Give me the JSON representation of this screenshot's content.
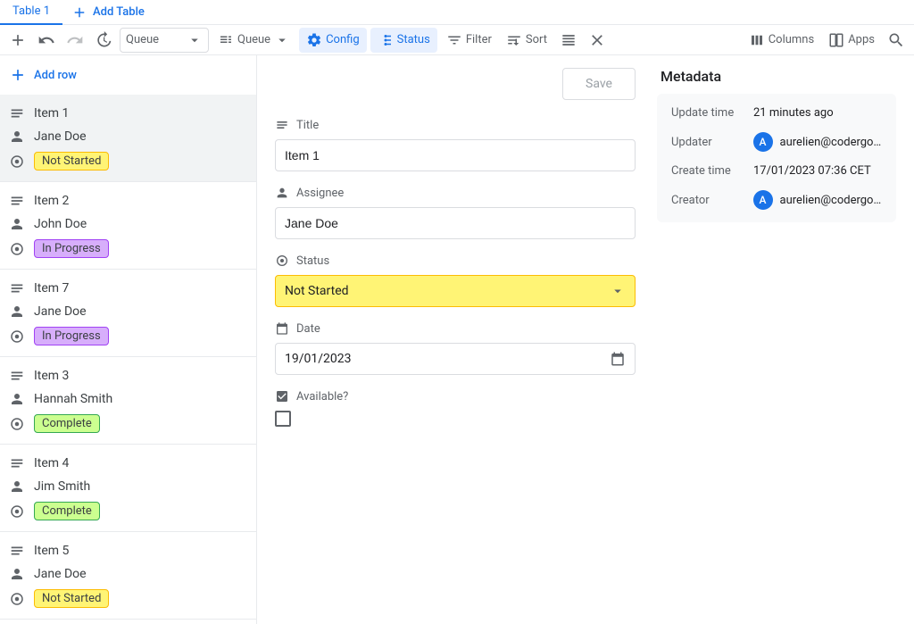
{
  "tabs": {
    "primary": "Table 1",
    "add": "Add Table"
  },
  "toolbar": {
    "view_select": "Queue",
    "layout_select": "Queue",
    "config": "Config",
    "status": "Status",
    "filter": "Filter",
    "sort": "Sort",
    "columns": "Columns",
    "apps": "Apps"
  },
  "sidebar": {
    "add_row": "Add row",
    "items": [
      {
        "title": "Item 1",
        "assignee": "Jane Doe",
        "status": "Not Started",
        "status_class": "pill-notstarted",
        "selected": true
      },
      {
        "title": "Item 2",
        "assignee": "John Doe",
        "status": "In Progress",
        "status_class": "pill-inprogress"
      },
      {
        "title": "Item 7",
        "assignee": "Jane Doe",
        "status": "In Progress",
        "status_class": "pill-inprogress"
      },
      {
        "title": "Item 3",
        "assignee": "Hannah Smith",
        "status": "Complete",
        "status_class": "pill-complete"
      },
      {
        "title": "Item 4",
        "assignee": "Jim Smith",
        "status": "Complete",
        "status_class": "pill-complete"
      },
      {
        "title": "Item 5",
        "assignee": "Jane Doe",
        "status": "Not Started",
        "status_class": "pill-notstarted"
      }
    ]
  },
  "detail": {
    "save": "Save",
    "fields": {
      "title_label": "Title",
      "title_value": "Item 1",
      "assignee_label": "Assignee",
      "assignee_value": "Jane Doe",
      "status_label": "Status",
      "status_value": "Not Started",
      "date_label": "Date",
      "date_value": "19/01/2023",
      "available_label": "Available?"
    }
  },
  "metadata": {
    "title": "Metadata",
    "rows": {
      "update_time_k": "Update time",
      "update_time_v": "21 minutes ago",
      "updater_k": "Updater",
      "updater_v": "aurelien@codergo...",
      "updater_initial": "A",
      "create_time_k": "Create time",
      "create_time_v": "17/01/2023 07:36 CET",
      "creator_k": "Creator",
      "creator_v": "aurelien@codergo...",
      "creator_initial": "A"
    }
  }
}
